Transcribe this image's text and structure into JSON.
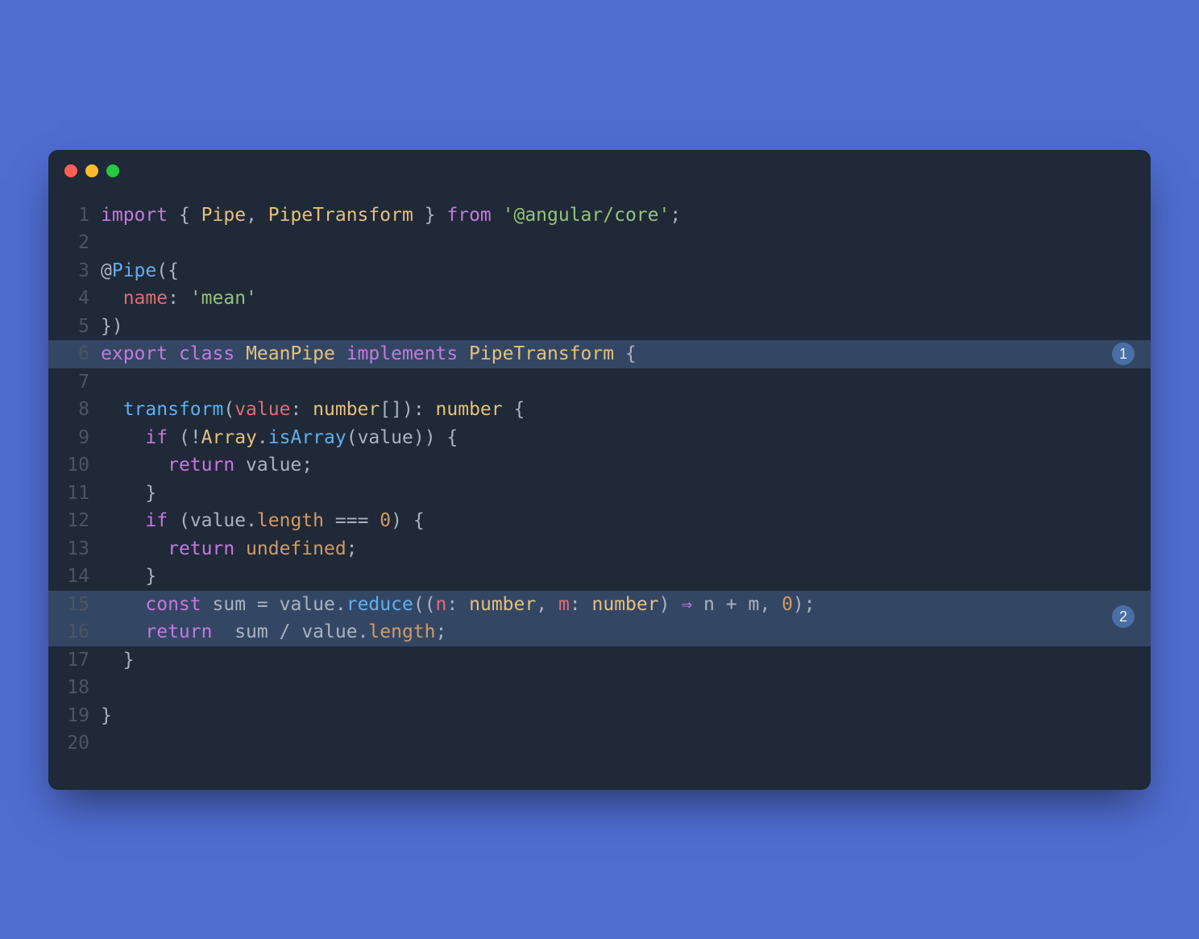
{
  "window": {
    "traffic_lights": [
      "close",
      "minimize",
      "maximize"
    ]
  },
  "annotations": {
    "badge1": "1",
    "badge2": "2"
  },
  "code": {
    "line_count": 20,
    "highlighted_lines": [
      6,
      15,
      16
    ],
    "tokens": {
      "import": "import",
      "lbrace": "{",
      "rbrace": "}",
      "pipe": "Pipe",
      "comma": ",",
      "pipe_transform": "PipeTransform",
      "from": "from",
      "angular_core": "'@angular/core'",
      "semi": ";",
      "at": "@",
      "lparen": "(",
      "rparen": ")",
      "name": "name",
      "colon": ":",
      "mean": "'mean'",
      "export": "export",
      "class": "class",
      "mean_pipe": "MeanPipe",
      "implements": "implements",
      "transform": "transform",
      "value": "value",
      "number": "number",
      "lbracket": "[",
      "rbracket": "]",
      "if": "if",
      "bang": "!",
      "array": "Array",
      "dot": ".",
      "is_array": "isArray",
      "return": "return",
      "length": "length",
      "triple_eq": "===",
      "zero": "0",
      "undefined": "undefined",
      "const": "const",
      "sum": "sum",
      "equals": "=",
      "reduce": "reduce",
      "n": "n",
      "m": "m",
      "arrow": "⇒",
      "plus": "+",
      "slash": "/"
    }
  }
}
